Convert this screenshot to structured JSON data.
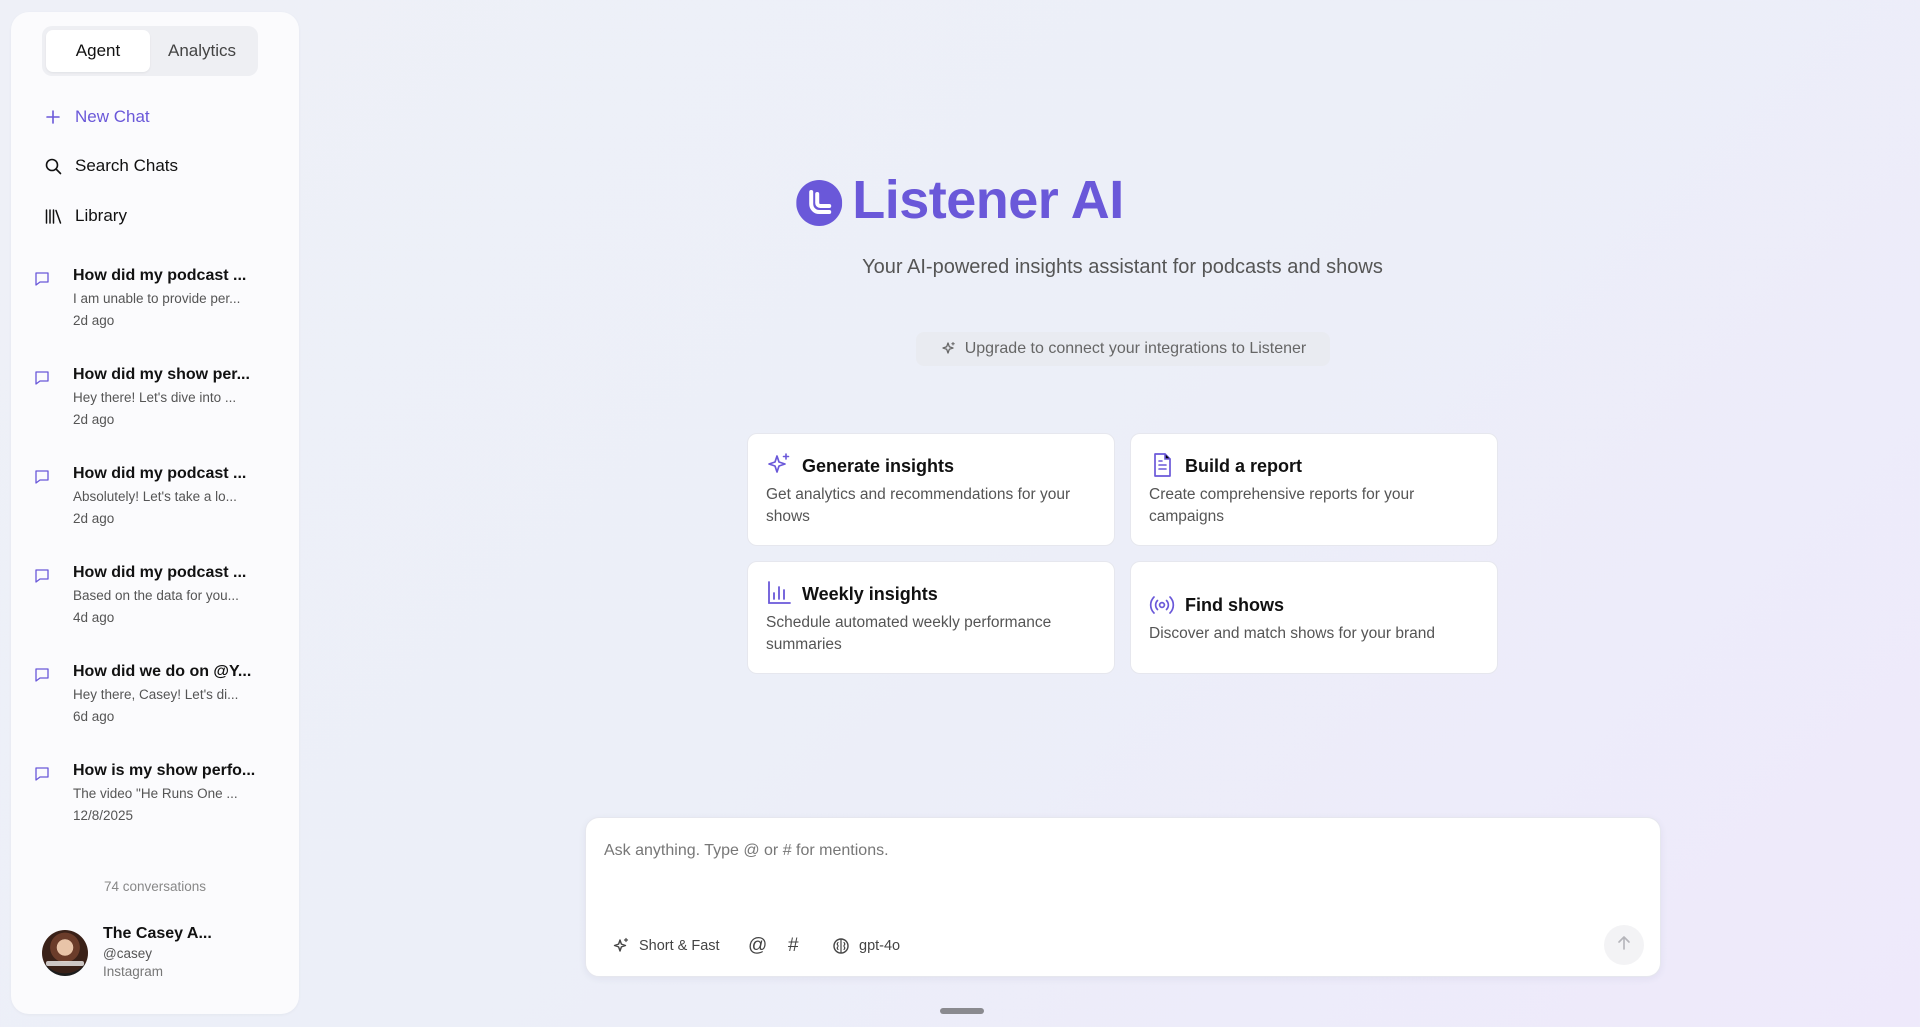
{
  "sidebar": {
    "tabs": [
      {
        "label": "Agent",
        "active": true
      },
      {
        "label": "Analytics",
        "active": false
      }
    ],
    "new_chat": "New Chat",
    "search_chats": "Search Chats",
    "library": "Library",
    "chats": [
      {
        "title": "How did my podcast ...",
        "preview": "I am unable to provide per...",
        "date": "2d ago"
      },
      {
        "title": "How did my show per...",
        "preview": "Hey there! Let's dive into ...",
        "date": "2d ago"
      },
      {
        "title": "How did my podcast ...",
        "preview": "Absolutely! Let's take a lo...",
        "date": "2d ago"
      },
      {
        "title": "How did my podcast ...",
        "preview": "Based on the data for you...",
        "date": "4d ago"
      },
      {
        "title": "How did we do on @Y...",
        "preview": "Hey there, Casey! Let's di...",
        "date": "6d ago"
      },
      {
        "title": "How is my show perfo...",
        "preview": "The video \"He Runs One ...",
        "date": "12/8/2025"
      }
    ],
    "conversation_count": "74 conversations",
    "profile": {
      "name": "The Casey A...",
      "handle": "@casey",
      "platform": "Instagram"
    }
  },
  "hero": {
    "title": "Listener AI",
    "subtitle": "Your AI-powered insights assistant for podcasts and shows",
    "upgrade": "Upgrade to connect your integrations to Listener"
  },
  "cards": [
    {
      "title": "Generate insights",
      "description": "Get analytics and recommendations for your shows",
      "icon": "sparkles-icon"
    },
    {
      "title": "Build a report",
      "description": "Create comprehensive reports for your campaigns",
      "icon": "document-icon"
    },
    {
      "title": "Weekly insights",
      "description": "Schedule automated weekly performance summaries",
      "icon": "bar-chart-icon"
    },
    {
      "title": "Find shows",
      "description": "Discover and match shows for your brand",
      "icon": "broadcast-icon"
    }
  ],
  "composer": {
    "placeholder": "Ask anything. Type @ or # for mentions.",
    "mode": "Short & Fast",
    "at_symbol": "@",
    "hash_symbol": "#",
    "model": "gpt-4o"
  },
  "colors": {
    "accent": "#6a58d9",
    "background": "#eef0f7",
    "card": "#ffffff"
  }
}
